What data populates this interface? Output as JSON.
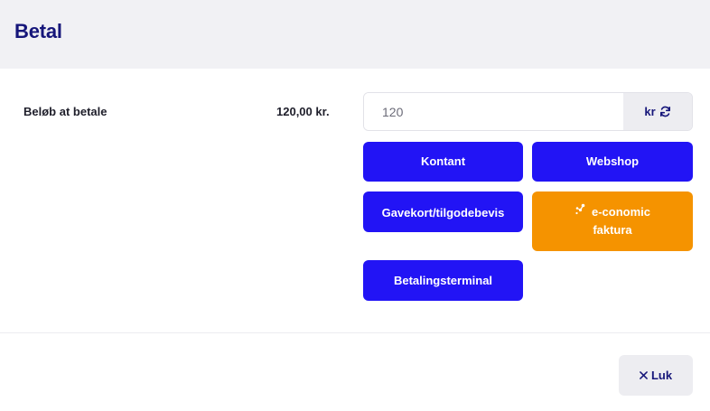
{
  "dialog": {
    "title": "Betal"
  },
  "amount": {
    "label": "Beløb at betale",
    "value": "120,00 kr.",
    "input_value": "120",
    "currency_label": "kr",
    "currency_icon": "refresh-icon"
  },
  "payment_methods": {
    "kontant": "Kontant",
    "webshop": "Webshop",
    "gavekort": "Gavekort/tilgodebevis",
    "economic_line1": "e-conomic",
    "economic_line2": "faktura",
    "economic_icon": "e-conomic-logo-icon",
    "terminal": "Betalingsterminal"
  },
  "footer": {
    "close_label": "Luk",
    "close_icon": "close-icon"
  },
  "colors": {
    "primary": "#2214f5",
    "economic": "#f59300",
    "title": "#16167a",
    "header_bg": "#f1f1f4"
  }
}
